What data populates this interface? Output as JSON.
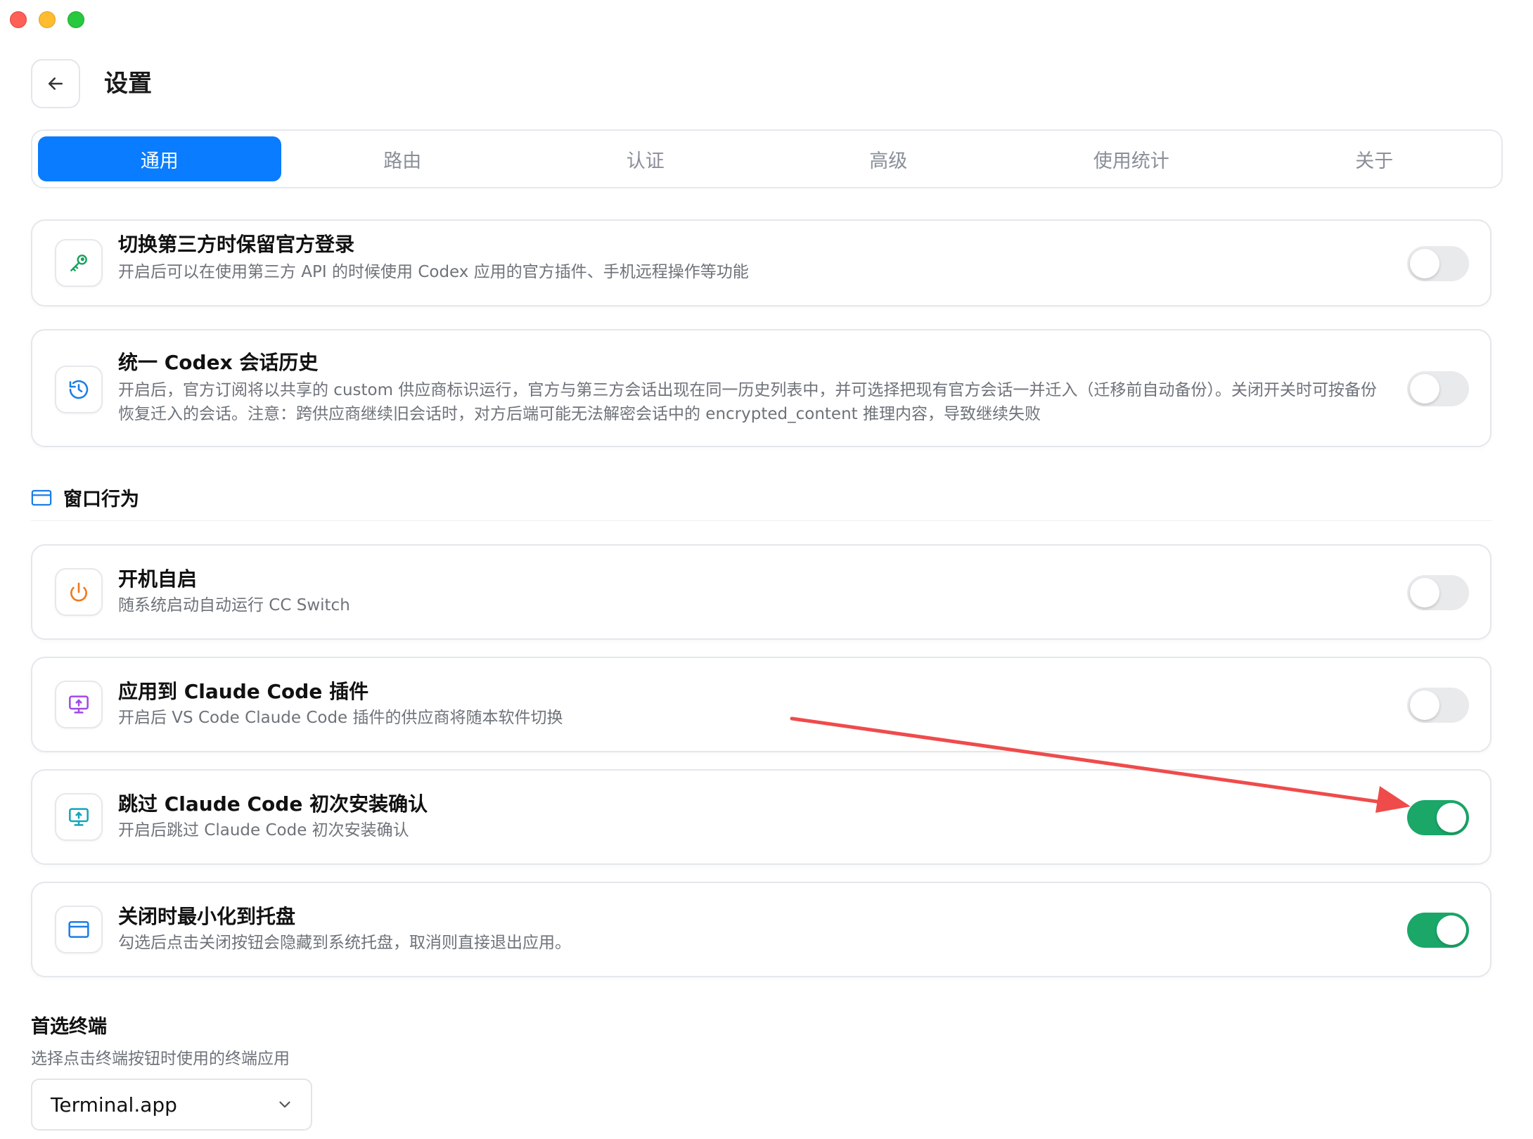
{
  "window": {
    "title": "设置"
  },
  "tabs": [
    {
      "label": "通用",
      "active": true
    },
    {
      "label": "路由",
      "active": false
    },
    {
      "label": "认证",
      "active": false
    },
    {
      "label": "高级",
      "active": false
    },
    {
      "label": "使用统计",
      "active": false
    },
    {
      "label": "关于",
      "active": false
    }
  ],
  "settings": {
    "keep_official": {
      "title": "切换第三方时保留官方登录",
      "desc": "开启后可以在使用第三方 API 的时候使用 Codex 应用的官方插件、手机远程操作等功能",
      "icon": "key-icon",
      "enabled": false
    },
    "unify_history": {
      "title": "统一 Codex 会话历史",
      "desc": "开启后，官方订阅将以共享的 custom 供应商标识运行，官方与第三方会话出现在同一历史列表中，并可选择把现有官方会话一并迁入（迁移前自动备份）。关闭开关时可按备份恢复迁入的会话。注意：跨供应商继续旧会话时，对方后端可能无法解密会话中的 encrypted_content 推理内容，导致继续失败",
      "icon": "history-icon",
      "enabled": false
    }
  },
  "window_section": {
    "label": "窗口行为",
    "icon": "window-icon"
  },
  "window_settings": {
    "autostart": {
      "title": "开机自启",
      "desc": "随系统启动自动运行 CC Switch",
      "icon": "power-icon",
      "enabled": false
    },
    "apply_plugin": {
      "title": "应用到 Claude Code 插件",
      "desc": "开启后 VS Code Claude Code 插件的供应商将随本软件切换",
      "icon": "monitor-upload-icon",
      "enabled": false
    },
    "skip_confirm": {
      "title": "跳过 Claude Code 初次安装确认",
      "desc": "开启后跳过 Claude Code 初次安装确认",
      "icon": "monitor-upload-icon",
      "enabled": true
    },
    "minimize_tray": {
      "title": "关闭时最小化到托盘",
      "desc": "勾选后点击关闭按钮会隐藏到系统托盘，取消则直接退出应用。",
      "icon": "window-icon",
      "enabled": true
    }
  },
  "terminal": {
    "title": "首选终端",
    "desc": "选择点击终端按钮时使用的终端应用",
    "selected": "Terminal.app"
  },
  "colors": {
    "accent": "#0a7cff",
    "toggle_on": "#1aa768",
    "annotation_arrow": "#ef4b4b"
  }
}
